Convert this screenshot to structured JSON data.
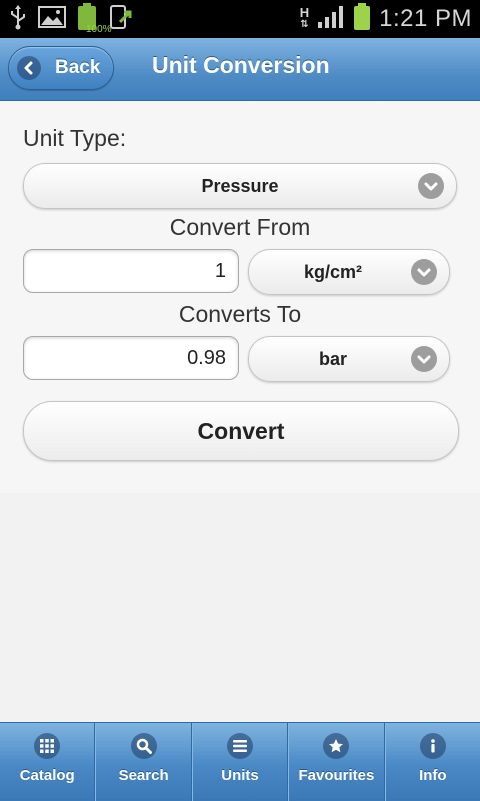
{
  "status_bar": {
    "battery_percent_label": "100%",
    "network_type": "H",
    "time": "1:21 PM"
  },
  "header": {
    "back_label": "Back",
    "title": "Unit Conversion"
  },
  "form": {
    "unit_type_label": "Unit Type:",
    "unit_type_value": "Pressure",
    "convert_from_label": "Convert From",
    "from_value": "1",
    "from_unit": "kg/cm²",
    "converts_to_label": "Converts To",
    "to_value": "0.98",
    "to_unit": "bar",
    "convert_button": "Convert"
  },
  "nav": {
    "items": [
      {
        "label": "Catalog",
        "icon": "grid-icon"
      },
      {
        "label": "Search",
        "icon": "search-icon"
      },
      {
        "label": "Units",
        "icon": "list-icon"
      },
      {
        "label": "Favourites",
        "icon": "star-icon"
      },
      {
        "label": "Info",
        "icon": "info-icon"
      }
    ]
  },
  "colors": {
    "header_blue": "#4f8cc6",
    "battery_green": "#9bd34b"
  }
}
